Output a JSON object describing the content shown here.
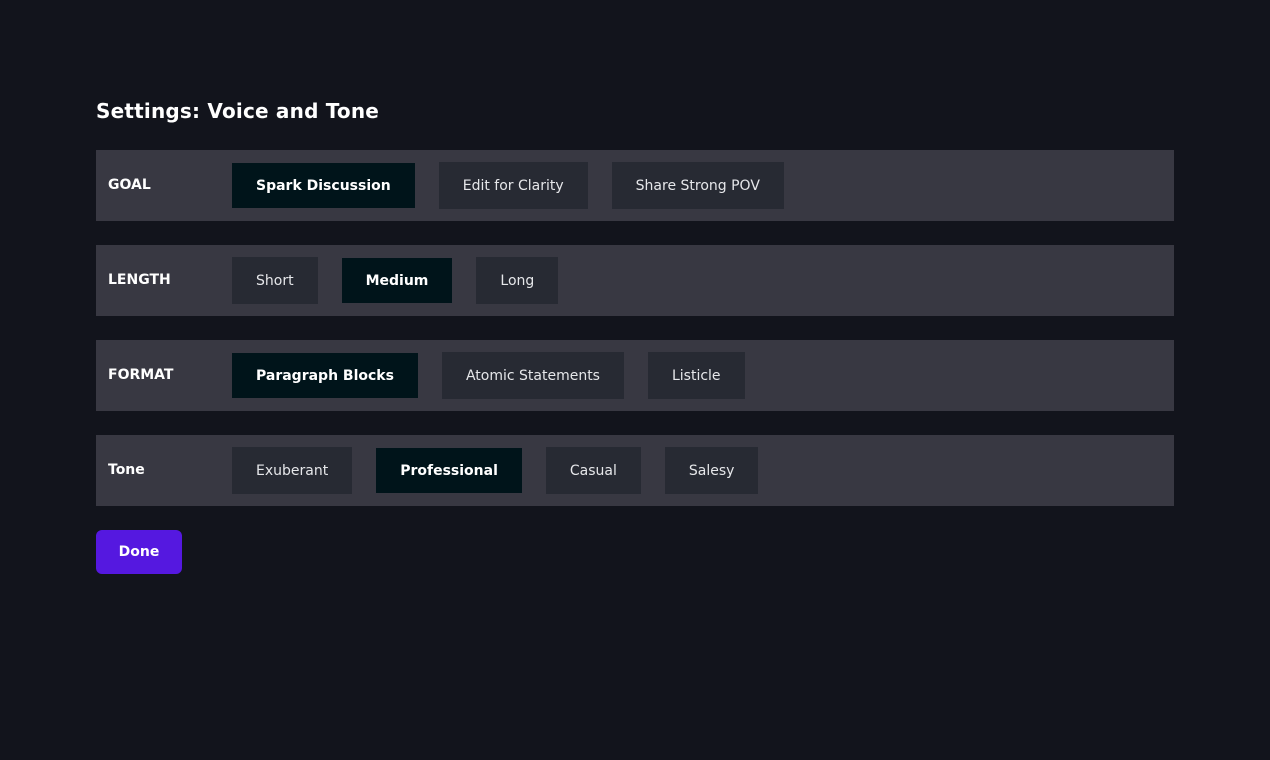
{
  "title": "Settings: Voice and Tone",
  "rows": [
    {
      "label": "GOAL",
      "options": [
        {
          "label": "Spark Discussion",
          "selected": true
        },
        {
          "label": "Edit for Clarity",
          "selected": false
        },
        {
          "label": "Share Strong POV",
          "selected": false
        }
      ]
    },
    {
      "label": "LENGTH",
      "options": [
        {
          "label": "Short",
          "selected": false
        },
        {
          "label": "Medium",
          "selected": true
        },
        {
          "label": "Long",
          "selected": false
        }
      ]
    },
    {
      "label": "FORMAT",
      "options": [
        {
          "label": "Paragraph Blocks",
          "selected": true
        },
        {
          "label": "Atomic Statements",
          "selected": false
        },
        {
          "label": "Listicle",
          "selected": false
        }
      ]
    },
    {
      "label": "Tone",
      "options": [
        {
          "label": "Exuberant",
          "selected": false
        },
        {
          "label": "Professional",
          "selected": true
        },
        {
          "label": "Casual",
          "selected": false
        },
        {
          "label": "Salesy",
          "selected": false
        }
      ]
    }
  ],
  "done_label": "Done",
  "colors": {
    "background": "#12141c",
    "row_background": "#383842",
    "option_background": "#272a33",
    "option_selected_background": "#00141a",
    "accent": "#5518e0"
  }
}
